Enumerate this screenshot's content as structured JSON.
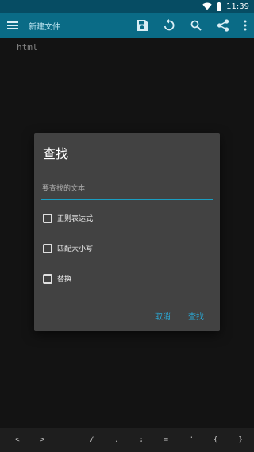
{
  "status_bar": {
    "time": "11:39"
  },
  "toolbar": {
    "title": "新建文件",
    "icons": [
      "menu-icon",
      "save-icon",
      "undo-icon",
      "search-icon",
      "share-icon",
      "more-vert-icon"
    ]
  },
  "editor": {
    "content": "html"
  },
  "dialog": {
    "title": "查找",
    "search_placeholder": "要查找的文本",
    "options": [
      "正则表达式",
      "匹配大小写",
      "替换"
    ],
    "cancel_label": "取消",
    "find_label": "查找"
  },
  "symbols": [
    "<",
    ">",
    "!",
    "/",
    ".",
    ";",
    "=",
    "\"",
    "{",
    "}"
  ],
  "colors": {
    "toolbar": "#0a6b86",
    "status_bar": "#064c63",
    "accent": "#2ba7d3",
    "dialog_bg": "#424242",
    "editor_bg": "#1e1e1e"
  }
}
